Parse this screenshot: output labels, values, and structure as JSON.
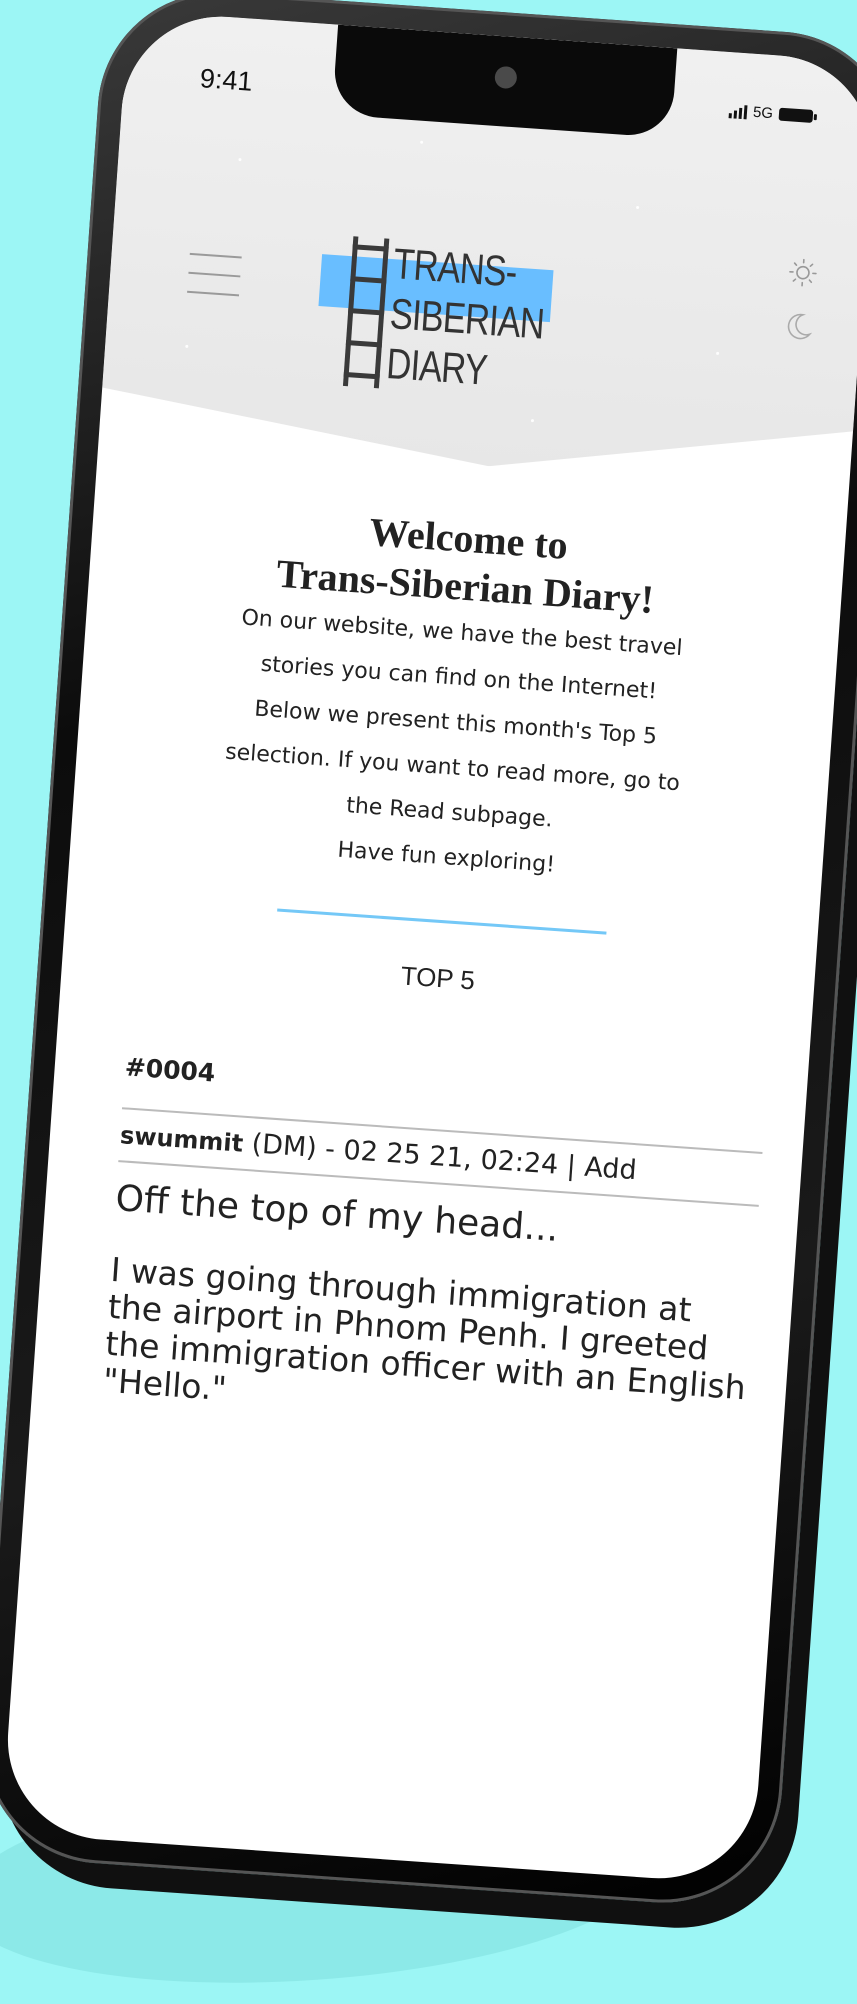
{
  "status": {
    "time": "9:41",
    "network": "5G"
  },
  "logo": {
    "line1": "TRANS-",
    "line2": "SIBERIAN",
    "line3": "DIARY"
  },
  "welcome": {
    "title_line1": "Welcome to",
    "title_line2": "Trans-Siberian Diary!",
    "lines": [
      "On our website, we have the best travel",
      "stories you can find on the Internet!",
      "Below we present this month's Top 5",
      "selection. If you want to read more, go to",
      "the Read subpage.",
      "Have fun exploring!"
    ]
  },
  "section": {
    "label": "TOP 5"
  },
  "post": {
    "id": "#0004",
    "author": "swummit",
    "meta_rest": " (DM) - 02 25 21, 02:24 | Add",
    "title": "Off the top of my head...",
    "body": "I was going through immigration at the airport in Phnom Penh. I greeted the immigration officer with an English \"Hello.\""
  },
  "colors": {
    "accent": "#69beff",
    "background": "#9cf6f5"
  }
}
